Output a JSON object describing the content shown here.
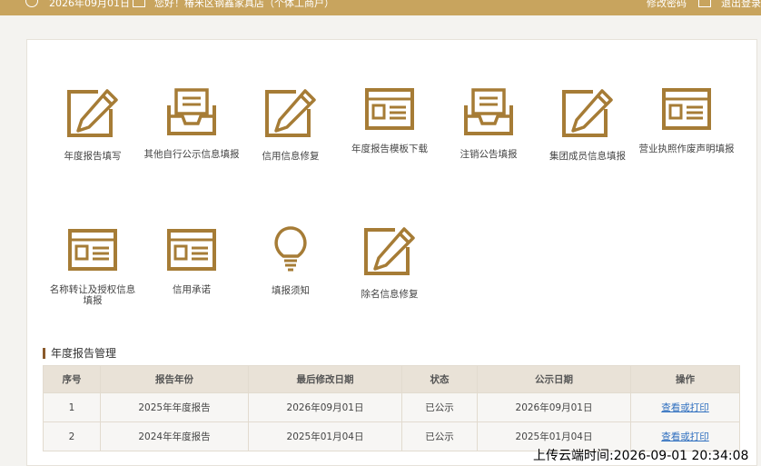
{
  "colors": {
    "accent": "#c8a45e",
    "icon": "#a67c36",
    "link": "#2f6fbf"
  },
  "topbar": {
    "date": "2026年09月01日",
    "greeting": "您好！椿米区钢鑫家具店（个体工商户）",
    "change_password": "修改密码",
    "logout": "退出登录"
  },
  "tiles": [
    {
      "label": "年度报告填写",
      "icon": "edit-icon"
    },
    {
      "label": "其他自行公示信息填报",
      "icon": "inbox-icon"
    },
    {
      "label": "信用信息修复",
      "icon": "edit-icon"
    },
    {
      "label": "年度报告模板下载",
      "icon": "window-icon"
    },
    {
      "label": "注销公告填报",
      "icon": "inbox-icon"
    },
    {
      "label": "集团成员信息填报",
      "icon": "edit-icon"
    },
    {
      "label": "营业执照作废声明填报",
      "icon": "window-icon"
    },
    {
      "label": "名称转让及授权信息填报",
      "icon": "window-icon"
    },
    {
      "label": "信用承诺",
      "icon": "window-icon"
    },
    {
      "label": "填报须知",
      "icon": "lightbulb-icon"
    },
    {
      "label": "除名信息修复",
      "icon": "edit-icon"
    }
  ],
  "section_title": "年度报告管理",
  "table": {
    "headers": [
      "序号",
      "报告年份",
      "最后修改日期",
      "状态",
      "公示日期",
      "操作"
    ],
    "rows": [
      [
        "1",
        "2025年年度报告",
        "2026年09月01日",
        "已公示",
        "2026年09月01日",
        "查看或打印"
      ],
      [
        "2",
        "2024年年度报告",
        "2025年01月04日",
        "已公示",
        "2025年01月04日",
        "查看或打印"
      ]
    ]
  },
  "upload_time": "上传云端时间:2026-09-01 20:34:08"
}
